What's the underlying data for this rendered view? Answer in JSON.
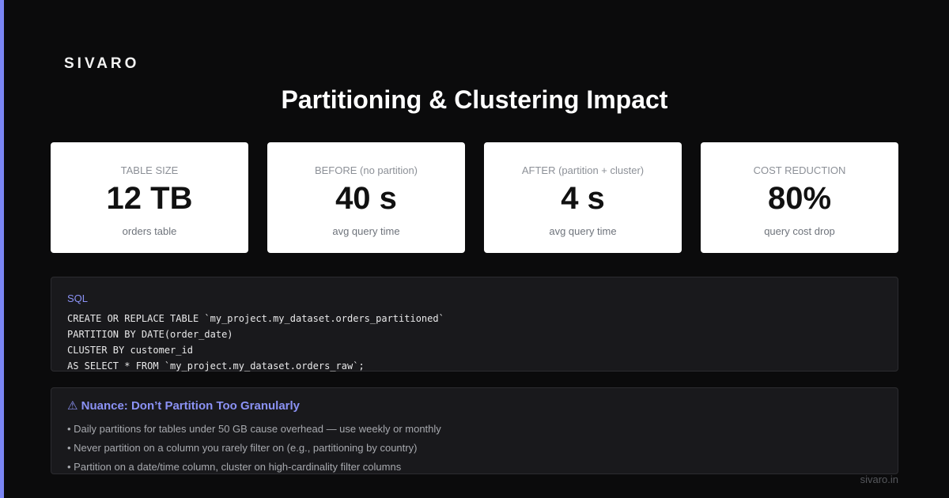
{
  "brand": "SIVARO",
  "title": "Partitioning & Clustering Impact",
  "stats": [
    {
      "label": "TABLE SIZE",
      "value": "12 TB",
      "sub": "orders table"
    },
    {
      "label": "BEFORE (no partition)",
      "value": "40 s",
      "sub": "avg query time"
    },
    {
      "label": "AFTER (partition + cluster)",
      "value": "4 s",
      "sub": "avg query time"
    },
    {
      "label": "COST REDUCTION",
      "value": "80%",
      "sub": "query cost drop"
    }
  ],
  "code": {
    "language": "SQL",
    "lines": [
      "CREATE OR REPLACE TABLE `my_project.my_dataset.orders_partitioned`",
      "PARTITION BY DATE(order_date)",
      "CLUSTER BY customer_id",
      "AS SELECT * FROM `my_project.my_dataset.orders_raw`;"
    ]
  },
  "nuance": {
    "title": "⚠ Nuance: Don’t Partition Too Granularly",
    "items": [
      "• Daily partitions for tables under 50 GB cause overhead — use weekly or monthly",
      "• Never partition on a column you rarely filter on (e.g., partitioning by country)",
      "• Partition on a date/time column, cluster on high-cardinality filter columns"
    ]
  },
  "footer": "sivaro.in",
  "colors": {
    "accent": "#7b86f5",
    "background": "#0b0b0c",
    "card": "#ffffff",
    "panel": "#19191c"
  }
}
